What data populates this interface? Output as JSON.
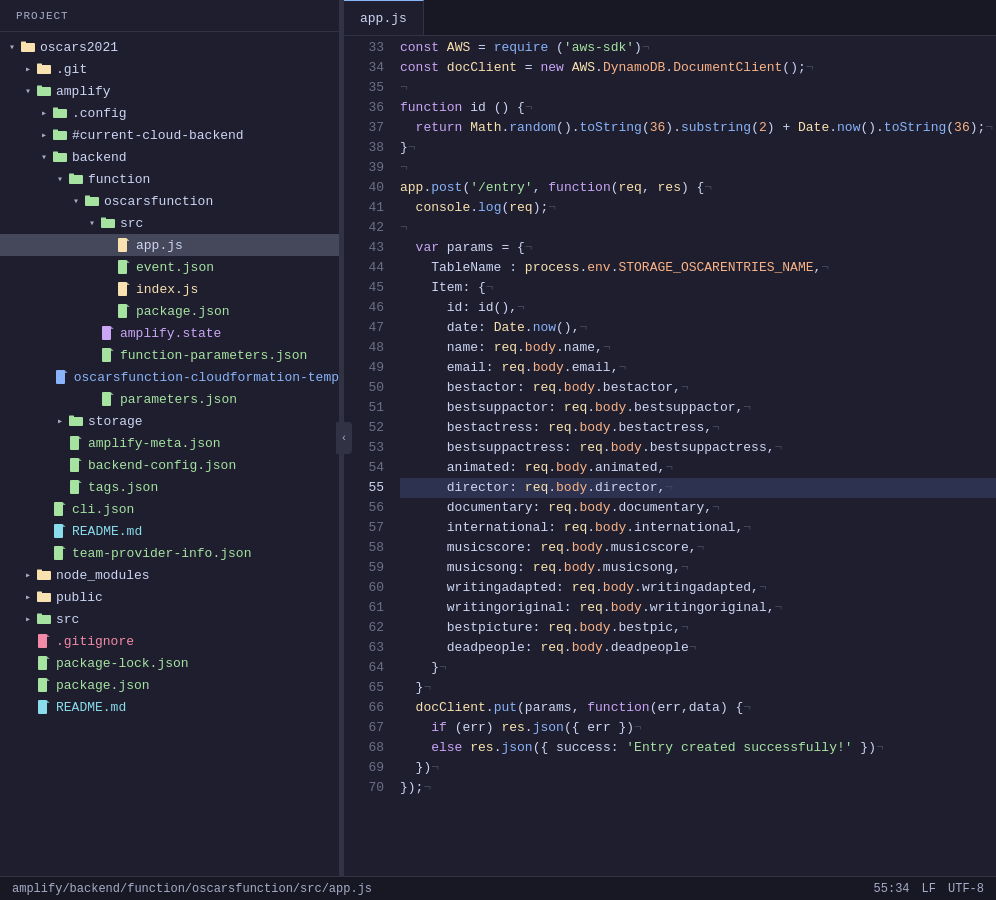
{
  "sidebar": {
    "header": "Project",
    "items": [
      {
        "id": "root",
        "label": "oscars2021",
        "type": "folder",
        "depth": 0,
        "expanded": true,
        "arrow": "▾"
      },
      {
        "id": "git",
        "label": ".git",
        "type": "folder",
        "depth": 1,
        "expanded": false,
        "arrow": "▸"
      },
      {
        "id": "amplify",
        "label": "amplify",
        "type": "folder",
        "depth": 1,
        "expanded": true,
        "arrow": "▾"
      },
      {
        "id": "config",
        "label": ".config",
        "type": "folder",
        "depth": 2,
        "expanded": false,
        "arrow": "▸"
      },
      {
        "id": "current-cloud",
        "label": "#current-cloud-backend",
        "type": "folder",
        "depth": 2,
        "expanded": false,
        "arrow": "▸"
      },
      {
        "id": "backend",
        "label": "backend",
        "type": "folder",
        "depth": 2,
        "expanded": true,
        "arrow": "▾"
      },
      {
        "id": "function",
        "label": "function",
        "type": "folder",
        "depth": 3,
        "expanded": true,
        "arrow": "▾"
      },
      {
        "id": "oscarsfunction",
        "label": "oscarsfunction",
        "type": "folder",
        "depth": 4,
        "expanded": true,
        "arrow": "▾"
      },
      {
        "id": "src",
        "label": "src",
        "type": "folder",
        "depth": 5,
        "expanded": true,
        "arrow": "▾"
      },
      {
        "id": "appjs",
        "label": "app.js",
        "type": "file-js",
        "depth": 6,
        "selected": true
      },
      {
        "id": "eventjson",
        "label": "event.json",
        "type": "file-json",
        "depth": 6
      },
      {
        "id": "indexjs",
        "label": "index.js",
        "type": "file-js",
        "depth": 6
      },
      {
        "id": "packagejson",
        "label": "package.json",
        "type": "file-json",
        "depth": 6
      },
      {
        "id": "amplifystate",
        "label": "amplify.state",
        "type": "file-state",
        "depth": 5
      },
      {
        "id": "functionparams",
        "label": "function-parameters.json",
        "type": "file-json",
        "depth": 5
      },
      {
        "id": "oscarsfunctioncloud",
        "label": "oscarsfunction-cloudformation-temp",
        "type": "file-config",
        "depth": 5
      },
      {
        "id": "parametersjson",
        "label": "parameters.json",
        "type": "file-json",
        "depth": 5
      },
      {
        "id": "storage",
        "label": "storage",
        "type": "folder",
        "depth": 3,
        "expanded": false,
        "arrow": "▸"
      },
      {
        "id": "amplifymeta",
        "label": "amplify-meta.json",
        "type": "file-json",
        "depth": 3
      },
      {
        "id": "backendconfig",
        "label": "backend-config.json",
        "type": "file-json",
        "depth": 3
      },
      {
        "id": "tagsjson",
        "label": "tags.json",
        "type": "file-json",
        "depth": 3
      },
      {
        "id": "clijson",
        "label": "cli.json",
        "type": "file-json",
        "depth": 2
      },
      {
        "id": "readmemd",
        "label": "README.md",
        "type": "file-md",
        "depth": 2
      },
      {
        "id": "teamprovider",
        "label": "team-provider-info.json",
        "type": "file-json",
        "depth": 2
      },
      {
        "id": "nodemodules",
        "label": "node_modules",
        "type": "folder",
        "depth": 1,
        "expanded": false,
        "arrow": "▸"
      },
      {
        "id": "public",
        "label": "public",
        "type": "folder",
        "depth": 1,
        "expanded": false,
        "arrow": "▸"
      },
      {
        "id": "src-root",
        "label": "src",
        "type": "folder",
        "depth": 1,
        "expanded": false,
        "arrow": "▸"
      },
      {
        "id": "gitignore",
        "label": ".gitignore",
        "type": "file-git",
        "depth": 1
      },
      {
        "id": "packagelockjson",
        "label": "package-lock.json",
        "type": "file-json",
        "depth": 1
      },
      {
        "id": "packagejson-root",
        "label": "package.json",
        "type": "file-json",
        "depth": 1
      },
      {
        "id": "readmemd-root",
        "label": "README.md",
        "type": "file-md",
        "depth": 1
      }
    ]
  },
  "editor": {
    "tab": "app.js",
    "lines": [
      {
        "num": 33,
        "content": "const AWS = require ('aws-sdk')¬",
        "highlighted": false
      },
      {
        "num": 34,
        "content": "const docClient = new AWS.DynamoDB.DocumentClient();¬",
        "highlighted": false
      },
      {
        "num": 35,
        "content": "¬",
        "highlighted": false
      },
      {
        "num": 36,
        "content": "function id () {¬",
        "highlighted": false
      },
      {
        "num": 37,
        "content": "  return Math.random().toString(36).substring(2) + Date.now().toString(36);¬",
        "highlighted": false
      },
      {
        "num": 38,
        "content": "}¬",
        "highlighted": false
      },
      {
        "num": 39,
        "content": "¬",
        "highlighted": false
      },
      {
        "num": 40,
        "content": "app.post('/entry', function(req, res) {¬",
        "highlighted": false
      },
      {
        "num": 41,
        "content": "  console.log(req);¬",
        "highlighted": false
      },
      {
        "num": 42,
        "content": "¬",
        "highlighted": false
      },
      {
        "num": 43,
        "content": "  var params = {¬",
        "highlighted": false
      },
      {
        "num": 44,
        "content": "    TableName : process.env.STORAGE_OSCARENTRIES_NAME,¬",
        "highlighted": false
      },
      {
        "num": 45,
        "content": "    Item: {¬",
        "highlighted": false
      },
      {
        "num": 46,
        "content": "      id: id(),¬",
        "highlighted": false
      },
      {
        "num": 47,
        "content": "      date: Date.now(),¬",
        "highlighted": false
      },
      {
        "num": 48,
        "content": "      name: req.body.name,¬",
        "highlighted": false
      },
      {
        "num": 49,
        "content": "      email: req.body.email,¬",
        "highlighted": false
      },
      {
        "num": 50,
        "content": "      bestactor: req.body.bestactor,¬",
        "highlighted": false
      },
      {
        "num": 51,
        "content": "      bestsuppactor: req.body.bestsuppactor,¬",
        "highlighted": false
      },
      {
        "num": 52,
        "content": "      bestactress: req.body.bestactress,¬",
        "highlighted": false
      },
      {
        "num": 53,
        "content": "      bestsuppactress: req.body.bestsuppactress,¬",
        "highlighted": false
      },
      {
        "num": 54,
        "content": "      animated: req.body.animated,¬",
        "highlighted": false
      },
      {
        "num": 55,
        "content": "      director: req.body.director,¬",
        "highlighted": true
      },
      {
        "num": 56,
        "content": "      documentary: req.body.documentary,¬",
        "highlighted": false
      },
      {
        "num": 57,
        "content": "      international: req.body.international,¬",
        "highlighted": false
      },
      {
        "num": 58,
        "content": "      musicscore: req.body.musicscore,¬",
        "highlighted": false
      },
      {
        "num": 59,
        "content": "      musicsong: req.body.musicsong,¬",
        "highlighted": false
      },
      {
        "num": 60,
        "content": "      writingadapted: req.body.writingadapted,¬",
        "highlighted": false
      },
      {
        "num": 61,
        "content": "      writingoriginal: req.body.writingoriginal,¬",
        "highlighted": false
      },
      {
        "num": 62,
        "content": "      bestpicture: req.body.bestpic,¬",
        "highlighted": false
      },
      {
        "num": 63,
        "content": "      deadpeople: req.body.deadpeople¬",
        "highlighted": false
      },
      {
        "num": 64,
        "content": "    }¬",
        "highlighted": false
      },
      {
        "num": 65,
        "content": "  }¬",
        "highlighted": false
      },
      {
        "num": 66,
        "content": "  docClient.put(params, function(err,data) {¬",
        "highlighted": false
      },
      {
        "num": 67,
        "content": "    if (err) res.json({ err })¬",
        "highlighted": false
      },
      {
        "num": 68,
        "content": "    else res.json({ success: 'Entry created successfully!' })¬",
        "highlighted": false
      },
      {
        "num": 69,
        "content": "  })¬",
        "highlighted": false
      },
      {
        "num": 70,
        "content": "});¬",
        "highlighted": false
      }
    ]
  },
  "statusbar": {
    "path": "amplify/backend/function/oscarsfunction/src/app.js",
    "position": "55:34",
    "encoding": "LF",
    "charset": "UTF-8"
  },
  "colors": {
    "background": "#1e1e2e",
    "sidebar_bg": "#1e1e2e",
    "selected_line": "#2d3250",
    "accent": "#89b4fa"
  }
}
